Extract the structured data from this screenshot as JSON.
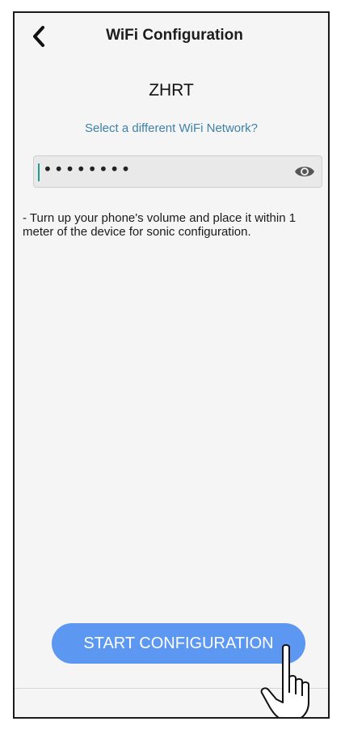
{
  "header": {
    "title": "WiFi Configuration",
    "back_icon": "chevron-left-icon"
  },
  "network": {
    "ssid": "ZHRT",
    "change_link": "Select a different WiFi Network?"
  },
  "password": {
    "value": "••••••••",
    "visibility_icon": "eye-icon"
  },
  "tip": {
    "text": "- Turn up your phone's volume and place it within 1 meter of the device for sonic configuration."
  },
  "action": {
    "start_label": "START CONFIGURATION",
    "pointer_icon": "hand-pointer-icon"
  },
  "colors": {
    "accent": "#5c97f2",
    "link": "#3d82a9",
    "caret": "#1f9c8f"
  }
}
